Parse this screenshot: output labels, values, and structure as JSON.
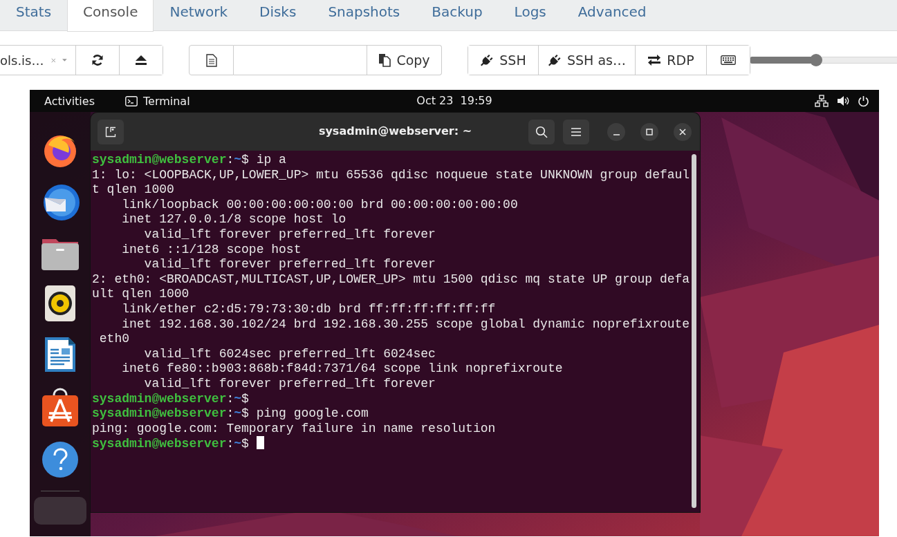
{
  "tabs": [
    {
      "label": "Stats",
      "selected": false
    },
    {
      "label": "Console",
      "selected": true
    },
    {
      "label": "Network",
      "selected": false
    },
    {
      "label": "Disks",
      "selected": false
    },
    {
      "label": "Snapshots",
      "selected": false
    },
    {
      "label": "Backup",
      "selected": false
    },
    {
      "label": "Logs",
      "selected": false
    },
    {
      "label": "Advanced",
      "selected": false
    }
  ],
  "toolbar": {
    "media_select": {
      "value": "ols.is…"
    },
    "copy_button": "Copy",
    "connect_buttons": [
      {
        "kind": "plug",
        "label": "SSH"
      },
      {
        "kind": "plug",
        "label": "SSH as…"
      },
      {
        "kind": "arrows",
        "label": "RDP"
      },
      {
        "kind": "keyboard"
      }
    ],
    "scale_slider": {
      "level": 0.35
    }
  },
  "desktop": {
    "top_bar": {
      "activities": "Activities",
      "app": "Terminal",
      "clock": "Oct 23  19:59"
    },
    "terminal": {
      "title": "sysadmin@webserver: ~",
      "lines": [
        {
          "kind": "prompt",
          "host": "sysadmin@webserver",
          "sep": ":",
          "dir": "~",
          "command": "$ ip a"
        },
        {
          "kind": "output",
          "text": "1: lo: <LOOPBACK,UP,LOWER_UP> mtu 65536 qdisc noqueue state UNKNOWN group defaul"
        },
        {
          "kind": "output",
          "text": "t qlen 1000"
        },
        {
          "kind": "output",
          "text": "    link/loopback 00:00:00:00:00:00 brd 00:00:00:00:00:00"
        },
        {
          "kind": "output",
          "text": "    inet 127.0.0.1/8 scope host lo"
        },
        {
          "kind": "output",
          "text": "       valid_lft forever preferred_lft forever"
        },
        {
          "kind": "output",
          "text": "    inet6 ::1/128 scope host"
        },
        {
          "kind": "output",
          "text": "       valid_lft forever preferred_lft forever"
        },
        {
          "kind": "output",
          "text": "2: eth0: <BROADCAST,MULTICAST,UP,LOWER_UP> mtu 1500 qdisc mq state UP group defa"
        },
        {
          "kind": "output",
          "text": "ult qlen 1000"
        },
        {
          "kind": "output",
          "text": "    link/ether c2:d5:79:73:30:db brd ff:ff:ff:ff:ff:ff"
        },
        {
          "kind": "output",
          "text": "    inet 192.168.30.102/24 brd 192.168.30.255 scope global dynamic noprefixroute"
        },
        {
          "kind": "output",
          "text": " eth0"
        },
        {
          "kind": "output",
          "text": "       valid_lft 6024sec preferred_lft 6024sec"
        },
        {
          "kind": "output",
          "text": "    inet6 fe80::b903:868b:f84d:7371/64 scope link noprefixroute"
        },
        {
          "kind": "output",
          "text": "       valid_lft forever preferred_lft forever"
        },
        {
          "kind": "prompt",
          "host": "sysadmin@webserver",
          "sep": ":",
          "dir": "~",
          "command": "$"
        },
        {
          "kind": "prompt",
          "host": "sysadmin@webserver",
          "sep": ":",
          "dir": "~",
          "command": "$ ping google.com"
        },
        {
          "kind": "output",
          "text": "ping: google.com: Temporary failure in name resolution"
        },
        {
          "kind": "prompt",
          "host": "sysadmin@webserver",
          "sep": ":",
          "dir": "~",
          "command": "$",
          "cursor": true
        }
      ]
    }
  }
}
